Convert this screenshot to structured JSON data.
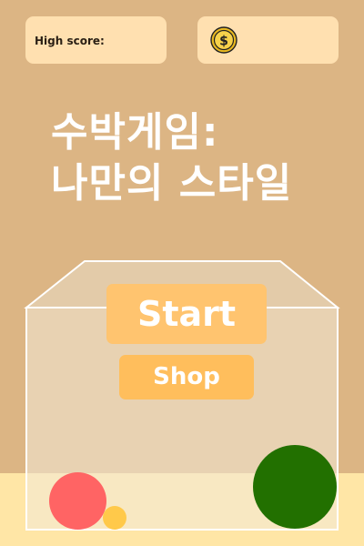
{
  "hud": {
    "high_score_label": "High score:",
    "high_score_value": "",
    "coin_icon": "coin-icon",
    "coin_count": ""
  },
  "title": {
    "line1": "수박게임:",
    "line2": "나만의 스타일"
  },
  "buttons": {
    "start_label": "Start",
    "shop_label": "Shop"
  },
  "fruits": [
    {
      "name": "red-fruit",
      "color": "#ff6464"
    },
    {
      "name": "yellow-fruit",
      "color": "#ffc94a"
    },
    {
      "name": "green-fruit",
      "color": "#227000"
    }
  ],
  "colors": {
    "background": "#dcb584",
    "floor": "#ffe6a6",
    "card": "#ffe0b0",
    "start_button": "#ffc46f",
    "shop_button": "#ffbe5c"
  }
}
